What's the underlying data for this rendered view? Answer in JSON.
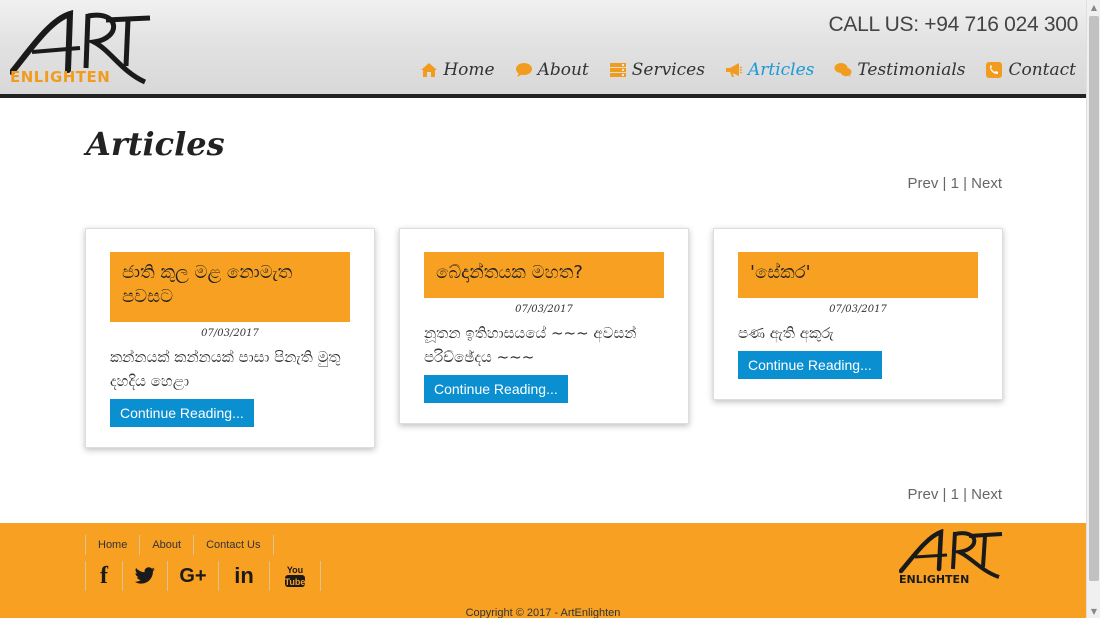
{
  "header": {
    "logo_text": "ART",
    "logo_sub": "ENLIGHTEN",
    "callus": "CALL US: +94 716 024 300"
  },
  "nav": [
    {
      "label": "Home",
      "icon": "home-icon",
      "active": false
    },
    {
      "label": "About",
      "icon": "speech-bubble-icon",
      "active": false
    },
    {
      "label": "Services",
      "icon": "server-icon",
      "active": false
    },
    {
      "label": "Articles",
      "icon": "megaphone-icon",
      "active": true
    },
    {
      "label": "Testimonials",
      "icon": "chat-bubbles-icon",
      "active": false
    },
    {
      "label": "Contact",
      "icon": "phone-icon",
      "active": false
    }
  ],
  "page": {
    "title": "Articles",
    "pager": {
      "prev": "Prev",
      "sep1": " | ",
      "current": "1",
      "sep2": " | ",
      "next": "Next"
    }
  },
  "articles": [
    {
      "title": "ජාති කුල මළ නොමැත පවසට",
      "date": "07/03/2017",
      "excerpt": "කන්නයක් කන්නයක් පාසා පිනැති මුතු දහදිය හෙළා",
      "button": "Continue Reading..."
    },
    {
      "title": "බේදාන්තයක මහත?",
      "date": "07/03/2017",
      "excerpt": "නූතන ඉතිහාසයයේ ~~~ අවසන් පරිච්ඡේදය ~~~",
      "button": "Continue Reading..."
    },
    {
      "title": "'සේකර'",
      "date": "07/03/2017",
      "excerpt": "පණ ඇති අකුරු",
      "button": "Continue Reading..."
    }
  ],
  "footer": {
    "links": [
      "Home",
      "About",
      "Contact Us"
    ],
    "social": [
      {
        "icon": "facebook-icon",
        "glyph": "f"
      },
      {
        "icon": "twitter-icon",
        "glyph": "bird"
      },
      {
        "icon": "google-plus-icon",
        "glyph": "G+"
      },
      {
        "icon": "linkedin-icon",
        "glyph": "in"
      },
      {
        "icon": "youtube-icon",
        "glyph": "You Tube"
      }
    ],
    "logo_text": "ART",
    "logo_sub": "ENLIGHTEN",
    "copyright": "Copyright © 2017 - ArtEnlighten"
  },
  "colors": {
    "accent_orange": "#f7a022",
    "button_blue": "#0a8fd1",
    "active_nav": "#1a9ad6",
    "nav_icon_orange": "#f29c1f"
  }
}
